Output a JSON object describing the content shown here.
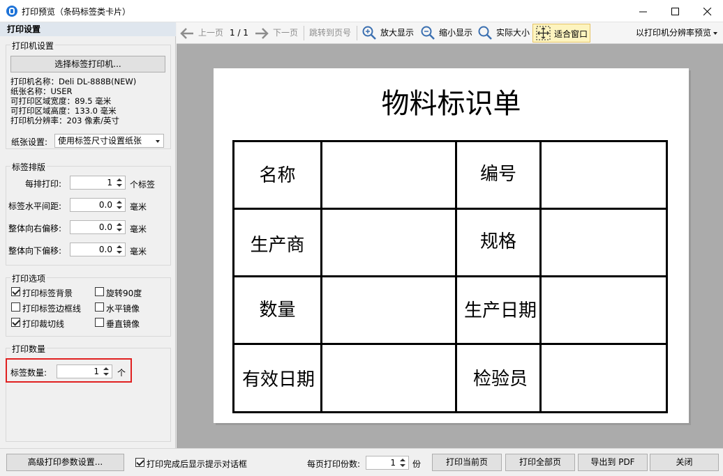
{
  "window": {
    "title": "打印预览（条码标签类卡片）"
  },
  "left_panel": {
    "header": "打印设置",
    "printer": {
      "title": "打印机设置",
      "select_button": "选择标签打印机...",
      "info": [
        "打印机名称：Deli DL-888B(NEW)",
        "纸张名称：USER",
        "可打印区域宽度：89.5 毫米",
        "可打印区域高度：133.0 毫米",
        "打印机分辨率：203 像素/英寸"
      ],
      "paper_label": "纸张设置:",
      "paper_value": "使用标签尺寸设置纸张"
    },
    "layout": {
      "title": "标签排版",
      "rows": [
        {
          "label": "每排打印:",
          "value": "1",
          "unit": "个标签"
        },
        {
          "label": "标签水平间距:",
          "value": "0.0",
          "unit": "毫米"
        },
        {
          "label": "整体向右偏移:",
          "value": "0.0",
          "unit": "毫米"
        },
        {
          "label": "整体向下偏移:",
          "value": "0.0",
          "unit": "毫米"
        }
      ]
    },
    "options": {
      "title": "打印选项",
      "items": [
        {
          "label": "打印标签背景",
          "checked": true
        },
        {
          "label": "旋转90度",
          "checked": false
        },
        {
          "label": "打印标签边框线",
          "checked": false
        },
        {
          "label": "水平镜像",
          "checked": false
        },
        {
          "label": "打印裁切线",
          "checked": true
        },
        {
          "label": "垂直镜像",
          "checked": false
        }
      ]
    },
    "quantity": {
      "title": "打印数量",
      "label": "标签数量:",
      "value": "1",
      "unit": "个"
    }
  },
  "toolbar": {
    "prev": "上一页",
    "page": "1 / 1",
    "next": "下一页",
    "goto": "跳转到页号",
    "zoom_in": "放大显示",
    "zoom_out": "缩小显示",
    "actual": "实际大小",
    "fit": "适合窗口",
    "resolution": "以打印机分辨率预览"
  },
  "document": {
    "title": "物料标识单",
    "cells": [
      "名称",
      "编号",
      "生产商",
      "规格",
      "数量",
      "生产日期",
      "有效日期",
      "检验员"
    ]
  },
  "bottom": {
    "advanced": "高级打印参数设置...",
    "show_dialog_label": "打印完成后显示提示对话框",
    "show_dialog_checked": true,
    "copies_label": "每页打印份数:",
    "copies_value": "1",
    "copies_unit": "份",
    "print_current": "打印当前页",
    "print_all": "打印全部页",
    "export_pdf": "导出到 PDF",
    "close": "关闭"
  }
}
